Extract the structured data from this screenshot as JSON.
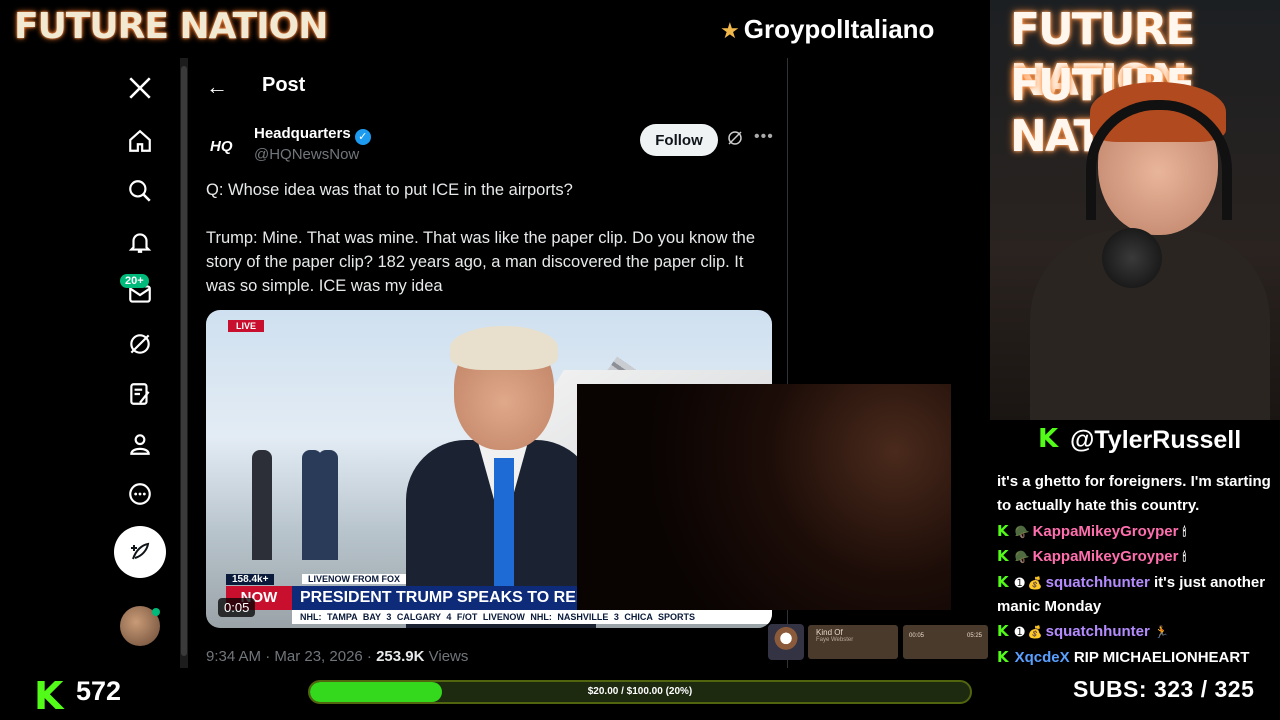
{
  "banner": {
    "brand": "FUTURE NATION",
    "stream_title": "GroypolItaliano"
  },
  "nav": {
    "notifications_badge": "20+"
  },
  "post": {
    "header_title": "Post",
    "author_logo": "HQ",
    "author_name": "Headquarters",
    "author_handle": "@HQNewsNow",
    "follow_label": "Follow",
    "text": "Q: Whose idea was that to put ICE in the airports?\n\nTrump: Mine. That was mine. That was like the paper clip. Do you know the story of the paper clip? 182 years ago, a man discovered the paper clip. It was so simple. ICE was my idea",
    "video": {
      "live_tag": "LIVE",
      "viewers": "158.4k+",
      "source": "LIVENOW FROM FOX",
      "headline": "PRESIDENT TRUMP SPEAKS TO REPORTERS",
      "now_tag": "NOW",
      "scores": "NHL: TAMPA BAY 3 CALGARY 4 F/OT LIVENOW NHL: NASHVILLE 3 CHICA SPORTS",
      "timecode": "0:05"
    },
    "time": "9:34 AM · Mar 23, 2026 · ",
    "views_count": "253.9K",
    "views_label": " Views"
  },
  "cam": {
    "neon_text": "FUTURE NATION"
  },
  "chat": {
    "channel": "@TylerRussell",
    "continuation": "it's a ghetto for foreigners. I'm starting to actually hate this country.",
    "messages": [
      {
        "user": "KappaMikeyGroyper",
        "text": ""
      },
      {
        "user": "KappaMikeyGroyper",
        "text": ""
      },
      {
        "user": "squatchhunter",
        "text": " it's just another manic Monday"
      },
      {
        "user": "squatchhunter",
        "text": ""
      },
      {
        "user": "XqcdeX",
        "text": " RIP MICHAELIONHEART"
      }
    ]
  },
  "now_playing": {
    "title": "Kind Of",
    "artist": "Faye Webster",
    "elapsed": "00:05",
    "duration": "05:25"
  },
  "bottom": {
    "follower_count": "572",
    "goal_text": "$20.00 / $100.00 (20%)",
    "goal_progress": 0.2,
    "subs_label": "SUBS:",
    "subs_value": "323 / 325"
  },
  "colors": {
    "kick_green": "#53fc18",
    "x_blue": "#1d9bf0",
    "follow_bg": "#eff3f4"
  },
  "icons": [
    "x-logo-icon",
    "home-icon",
    "search-icon",
    "bell-icon",
    "mail-icon",
    "grok-icon",
    "compose-list-icon",
    "profile-icon",
    "more-circle-icon",
    "compose-post-icon"
  ]
}
